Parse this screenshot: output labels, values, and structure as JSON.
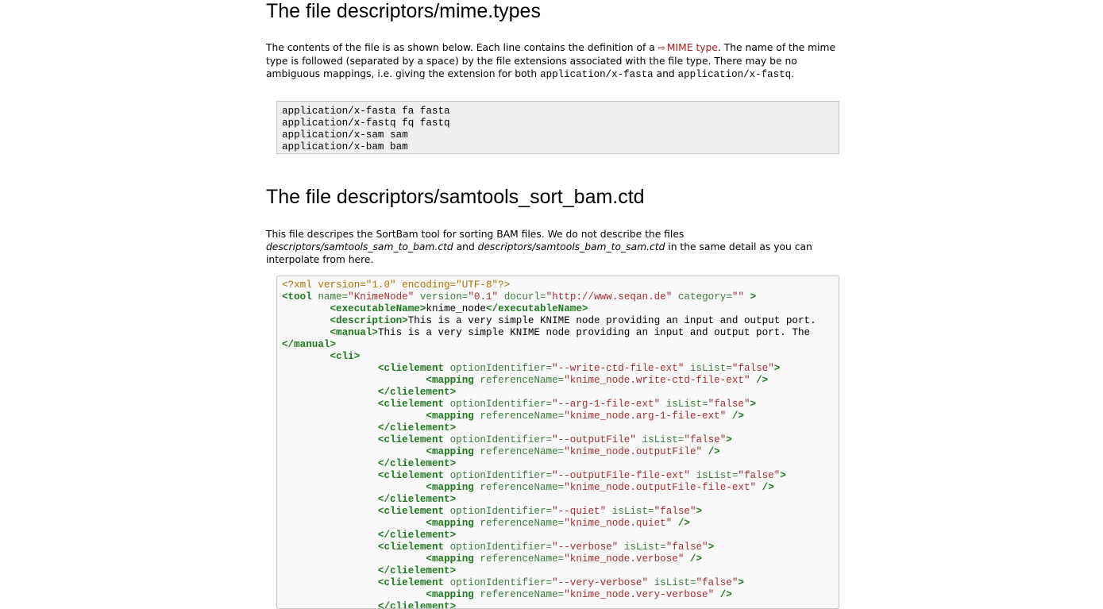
{
  "section1": {
    "title": "The file descriptors/mime.types",
    "para_before_link": "The contents of the file is as shown below. Each line contains the definition of a ",
    "link_text": "MIME type",
    "para_after_link": ". The name of the mime type is followed (separated by a space) by the file extensions associated with the file type. There may be no ambiguous mappings, i.e. giving the extension for both ",
    "code1": "application/x-fasta",
    "and_text": " and ",
    "code2": "application/x-fastq",
    "end_text": ".",
    "code_lines": [
      "application/x-fasta fa fasta",
      "application/x-fastq fq fastq",
      "application/x-sam sam",
      "application/x-bam bam"
    ]
  },
  "section2": {
    "title": "The file descriptors/samtools_sort_bam.ctd",
    "para_start": "This file descripes the SortBam tool for sorting BAM files. We do not describe the files ",
    "em1": "descriptors/samtools_sam_to_bam.ctd",
    "mid": " and ",
    "em2": "descriptors/samtools_bam_to_sam.ctd",
    "para_end": " in the same detail as you can interpolate from here.",
    "xml": {
      "decl": "<?xml version=\"1.0\" encoding=\"UTF-8\"?>",
      "tool_name": "\"KnimeNode\"",
      "tool_version": "\"0.1\"",
      "tool_docurl": "\"http://www.seqan.de\"",
      "tool_category": "\"\"",
      "executable_name": "knime_node",
      "description": "This is a very simple KNIME node providing an input and output port.",
      "manual": "This is a very simple KNIME node providing an input and output port. The",
      "clielements": [
        {
          "id": "\"--write-ctd-file-ext\"",
          "islist": "\"false\"",
          "ref": "\"knime_node.write-ctd-file-ext\""
        },
        {
          "id": "\"--arg-1-file-ext\"",
          "islist": "\"false\"",
          "ref": "\"knime_node.arg-1-file-ext\""
        },
        {
          "id": "\"--outputFile\"",
          "islist": "\"false\"",
          "ref": "\"knime_node.outputFile\""
        },
        {
          "id": "\"--outputFile-file-ext\"",
          "islist": "\"false\"",
          "ref": "\"knime_node.outputFile-file-ext\""
        },
        {
          "id": "\"--quiet\"",
          "islist": "\"false\"",
          "ref": "\"knime_node.quiet\""
        },
        {
          "id": "\"--verbose\"",
          "islist": "\"false\"",
          "ref": "\"knime_node.verbose\""
        },
        {
          "id": "\"--very-verbose\"",
          "islist": "\"false\"",
          "ref": "\"knime_node.very-verbose\""
        }
      ]
    }
  }
}
